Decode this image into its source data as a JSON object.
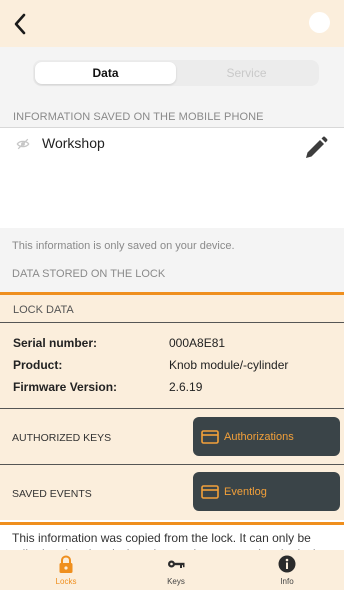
{
  "header": {
    "back_icon": "chevron-left-icon"
  },
  "segments": {
    "data_label": "Data",
    "service_label": "Service"
  },
  "phone_section": {
    "title": "INFORMATION SAVED ON THE MOBILE PHONE",
    "name": "Workshop",
    "visibility_icon": "eye-off-icon",
    "edit_icon": "pencil-icon",
    "device_note": "This information is only saved on your device."
  },
  "lock_section": {
    "title": "DATA STORED ON THE LOCK",
    "lock_data_title": "LOCK DATA",
    "fields": [
      {
        "label": "Serial number:",
        "value": "000A8E81"
      },
      {
        "label": "Product:",
        "value": "Knob module/-cylinder"
      },
      {
        "label": "Firmware Version:",
        "value": "2.6.19"
      }
    ],
    "authorized_keys_label": "AUTHORIZED KEYS",
    "authorizations_button": "Authorizations",
    "saved_events_label": "SAVED EVENTS",
    "eventlog_button": "Eventlog",
    "copied_note": "This information was copied from the lock. It can only be edited and updated when the app is connected to the lock."
  },
  "tabs": [
    {
      "label": "Locks",
      "icon": "lock-icon",
      "active": true
    },
    {
      "label": "Keys",
      "icon": "key-icon",
      "active": false
    },
    {
      "label": "Info",
      "icon": "info-icon",
      "active": false
    }
  ],
  "colors": {
    "accent": "#ef8f1e",
    "peach_background": "#fbeedc",
    "button_background": "#3a4448",
    "button_text": "#f2a03a"
  }
}
